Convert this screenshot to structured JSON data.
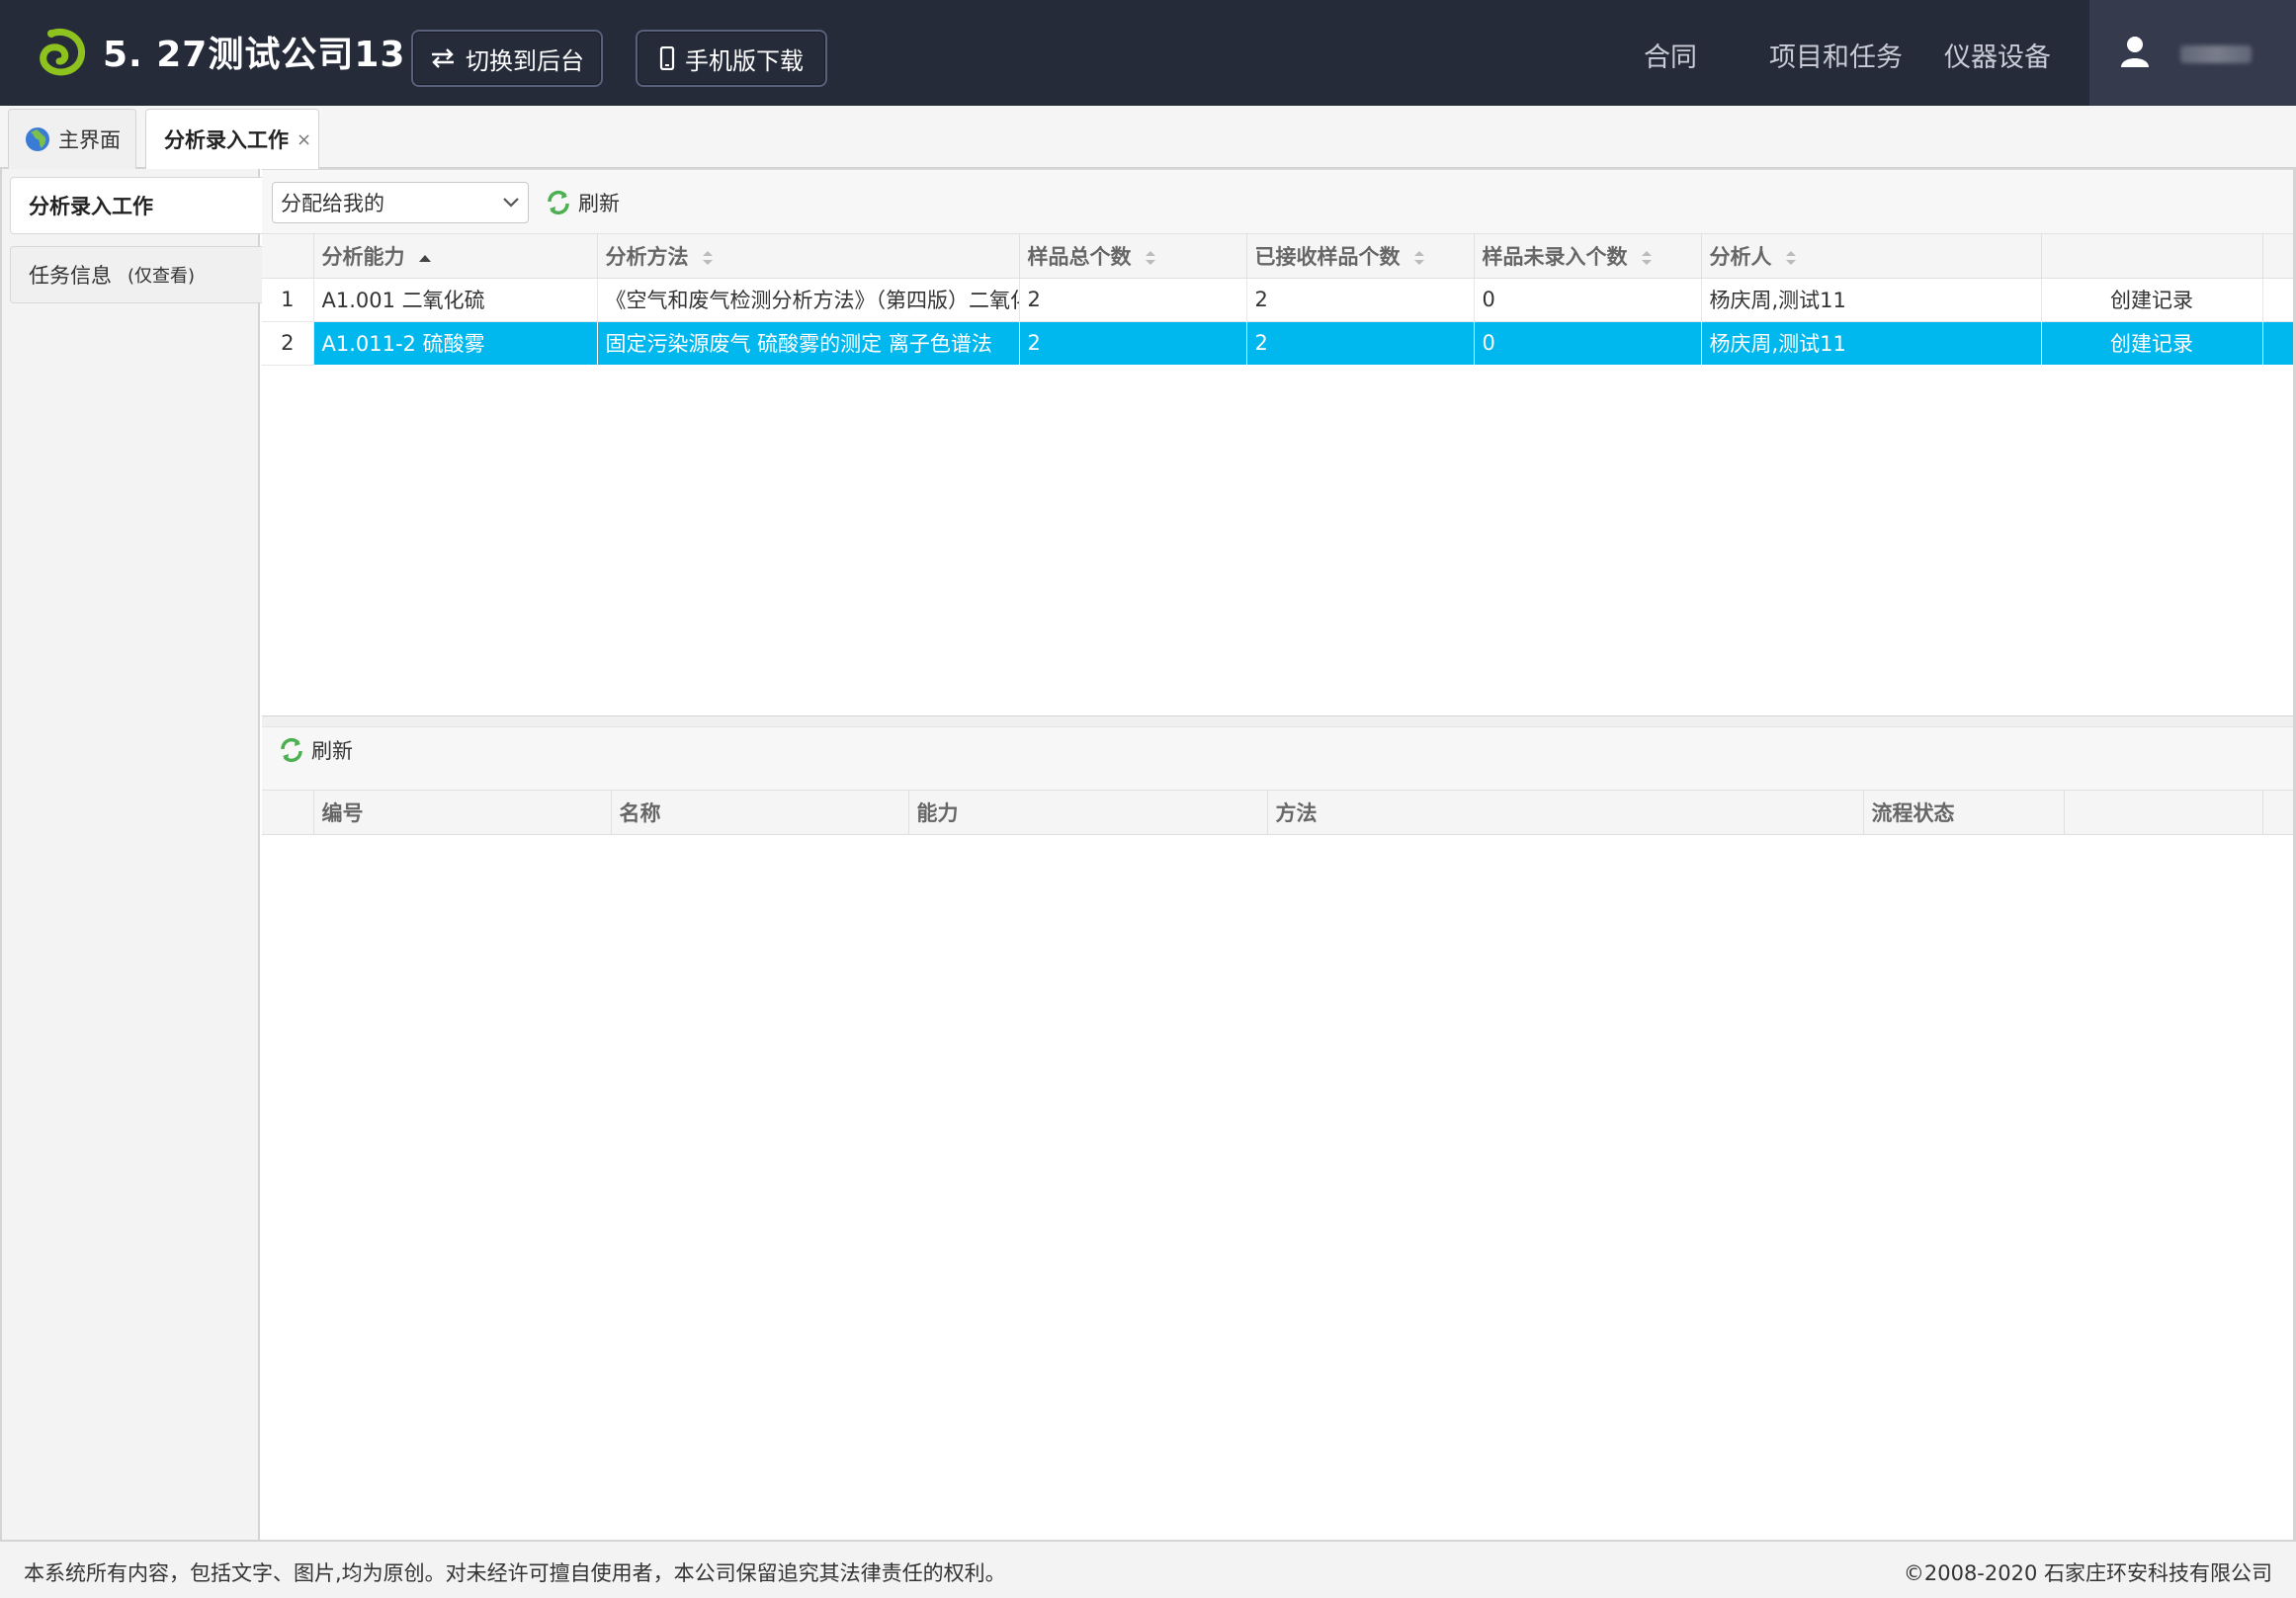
{
  "header": {
    "company_name": "5. 27测试公司13",
    "switch_label": "切换到后台",
    "mobile_label": "手机版下载",
    "nav": [
      "合同",
      "项目和任务",
      "仪器设备"
    ]
  },
  "tabs": {
    "home": "主界面",
    "analysis": "分析录入工作",
    "close_glyph": "×"
  },
  "sidebar": {
    "items": [
      {
        "label": "分析录入工作",
        "note": ""
      },
      {
        "label": "任务信息",
        "note": "(仅查看)"
      }
    ]
  },
  "toolbar": {
    "filter_value": "分配给我的",
    "refresh_label": "刷新"
  },
  "top_table": {
    "columns": [
      "分析能力",
      "分析方法",
      "样品总个数",
      "已接收样品个数",
      "样品未录入个数",
      "分析人",
      ""
    ],
    "rows": [
      {
        "num": "1",
        "capability": "A1.001 二氧化硫",
        "method": "《空气和废气检测分析方法》（第四版）二氧化硫",
        "total": "2",
        "received": "2",
        "unentered": "0",
        "analyst": "杨庆周,测试11",
        "action": "创建记录"
      },
      {
        "num": "2",
        "capability": "A1.011-2 硫酸雾",
        "method": "固定污染源废气 硫酸雾的测定 离子色谱法",
        "total": "2",
        "received": "2",
        "unentered": "0",
        "analyst": "杨庆周,测试11",
        "action": "创建记录"
      }
    ],
    "selected_row": 2
  },
  "lower": {
    "refresh_label": "刷新",
    "columns": [
      "编号",
      "名称",
      "能力",
      "方法",
      "流程状态",
      ""
    ]
  },
  "footer": {
    "left": "本系统所有内容，包括文字、图片,均为原创。对未经许可擅自使用者，本公司保留追究其法律责任的权利。",
    "right": "©2008-2020 石家庄环安科技有限公司"
  },
  "colors": {
    "header_bg": "#262b3a",
    "selected_row": "#00b7ee",
    "logo_green": "#8dc21f"
  }
}
